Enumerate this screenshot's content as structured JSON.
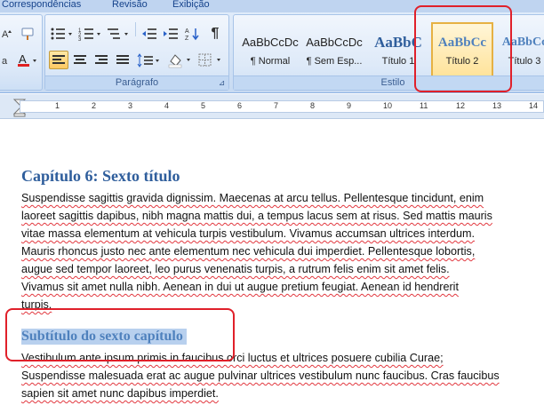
{
  "tabs": [
    {
      "label": "Correspondências"
    },
    {
      "label": "Revisão"
    },
    {
      "label": "Exibição"
    }
  ],
  "groups": {
    "paragraph": {
      "title": "Parágrafo"
    },
    "styles": {
      "title": "Estilo"
    }
  },
  "styles": [
    {
      "sample": "AaBbCcDc",
      "name": "¶ Normal"
    },
    {
      "sample": "AaBbCcDc",
      "name": "¶ Sem Esp..."
    },
    {
      "sample": "AaBbC",
      "name": "Título 1"
    },
    {
      "sample": "AaBbCc",
      "name": "Título 2"
    },
    {
      "sample": "AaBbCc",
      "name": "Título 3"
    }
  ],
  "selected_style": "Título 2",
  "ruler": {
    "numbers": [
      "1",
      "2",
      "3",
      "4",
      "5",
      "6",
      "7",
      "8",
      "9",
      "10",
      "11",
      "12",
      "13",
      "14"
    ]
  },
  "document": {
    "heading": "Capítulo 6: Sexto título",
    "para1": [
      "Suspendisse sagittis gravida dignissim. Maecenas at arcu tellus. Pellentesque tincidunt, enim",
      "laoreet sagittis dapibus, nibh magna mattis dui, a tempus lacus sem at risus. Sed mattis mauris",
      "vitae massa elementum at vehicula turpis vestibulum. Vivamus accumsan ultrices interdum.",
      "Mauris rhoncus justo nec ante elementum nec vehicula dui imperdiet. Pellentesque lobortis,",
      "augue sed tempor laoreet, leo purus venenatis turpis, a rutrum felis enim sit amet felis.",
      "Vivamus sit amet nulla nibh. Aenean in dui ut augue pretium feugiat. Aenean id hendrerit",
      "turpis."
    ],
    "subheading": "Subtítulo do sexto capítulo",
    "para2": [
      "Vestibulum ante ipsum primis in faucibus orci luctus et ultrices posuere cubilia Curae;",
      "Suspendisse malesuada erat ac augue pulvinar ultrices vestibulum nunc faucibus. Cras faucibus",
      "sapien sit amet nunc dapibus imperdiet."
    ]
  },
  "colors": {
    "heading": "#2f5e9c",
    "subheading": "#4f81bd",
    "subheading_highlight": "#b8d0ee",
    "annotation": "#e0202a",
    "selected_style": "#ffe39b"
  },
  "icons": {
    "font_group": [
      "text-direction-icon",
      "format-painter-icon",
      "clear-format-icon",
      "font-color-icon"
    ],
    "paragraph_group": [
      "bullets-icon",
      "numbering-icon",
      "multilevel-list-icon",
      "decrease-indent-icon",
      "increase-indent-icon",
      "sort-icon",
      "pilcrow-icon",
      "align-left-icon",
      "align-center-icon",
      "align-right-icon",
      "justify-icon",
      "line-spacing-icon",
      "shading-icon",
      "borders-icon"
    ]
  }
}
